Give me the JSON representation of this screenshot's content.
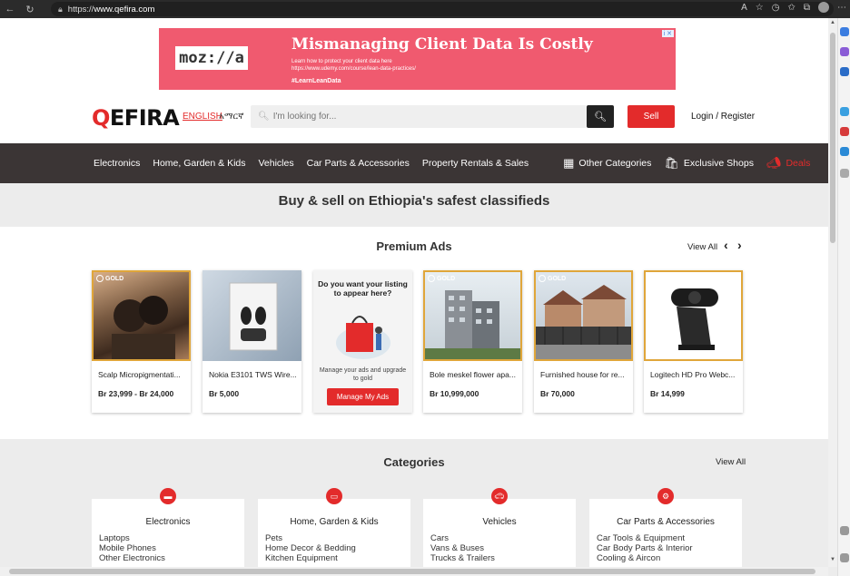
{
  "browser": {
    "url_prefix": "https://",
    "url_host": "www.qefira.com",
    "back_icon": "back-arrow-icon",
    "refresh_icon": "refresh-icon"
  },
  "ad": {
    "logo_text": "moz://a",
    "title": "Mismanaging Client Data Is Costly",
    "subtitle_line1": "Learn how to protect your client data here",
    "subtitle_line2": "https://www.udemy.com/course/lean-data-practices/",
    "hashtag": "#LearnLeanData",
    "close_label": "i ✕"
  },
  "header": {
    "logo_first": "Q",
    "logo_rest": "EFIRA",
    "lang_en": "ENGLISH",
    "lang_am": "አማርኛ",
    "search_placeholder": "I'm looking for...",
    "sell_label": "Sell",
    "login_label": "Login / Register"
  },
  "nav": {
    "electronics": "Electronics",
    "home_garden": "Home, Garden & Kids",
    "vehicles": "Vehicles",
    "car_parts": "Car Parts & Accessories",
    "property": "Property Rentals & Sales",
    "other": "Other Categories",
    "shops": "Exclusive Shops",
    "deals": "Deals"
  },
  "tagline": "Buy & sell on Ethiopia's safest classifieds",
  "premium": {
    "title": "Premium Ads",
    "view_all": "View All",
    "gold_label": "GOLD",
    "cards": [
      {
        "title": "Scalp Micropigmentati...",
        "price": "Br 23,999 - Br 24,000",
        "gold": true
      },
      {
        "title": "Nokia E3101 TWS Wire...",
        "price": "Br 5,000",
        "gold": false
      },
      {
        "title": "Bole meskel flower apa...",
        "price": "Br 10,999,000",
        "gold": true
      },
      {
        "title": "Furnished house for re...",
        "price": "Br 70,000",
        "gold": true
      },
      {
        "title": "Logitech HD Pro Webc...",
        "price": "Br 14,999",
        "gold": true
      }
    ],
    "promo": {
      "question": "Do you want your listing to appear here?",
      "text": "Manage your ads and upgrade to gold",
      "button": "Manage My Ads"
    }
  },
  "categories": {
    "title": "Categories",
    "view_all": "View All",
    "items": [
      {
        "name": "Electronics",
        "subs": [
          "Laptops",
          "Mobile Phones",
          "Other Electronics"
        ]
      },
      {
        "name": "Home, Garden & Kids",
        "subs": [
          "Pets",
          "Home Decor & Bedding",
          "Kitchen Equipment"
        ]
      },
      {
        "name": "Vehicles",
        "subs": [
          "Cars",
          "Vans & Buses",
          "Trucks & Trailers"
        ]
      },
      {
        "name": "Car Parts & Accessories",
        "subs": [
          "Car Tools & Equipment",
          "Car Body Parts & Interior",
          "Cooling & Aircon"
        ]
      }
    ]
  },
  "colors": {
    "brand_red": "#e32b2b",
    "nav_bg": "#3b3535",
    "gold": "#e0a63a",
    "ad_bg": "#f05a6f"
  }
}
